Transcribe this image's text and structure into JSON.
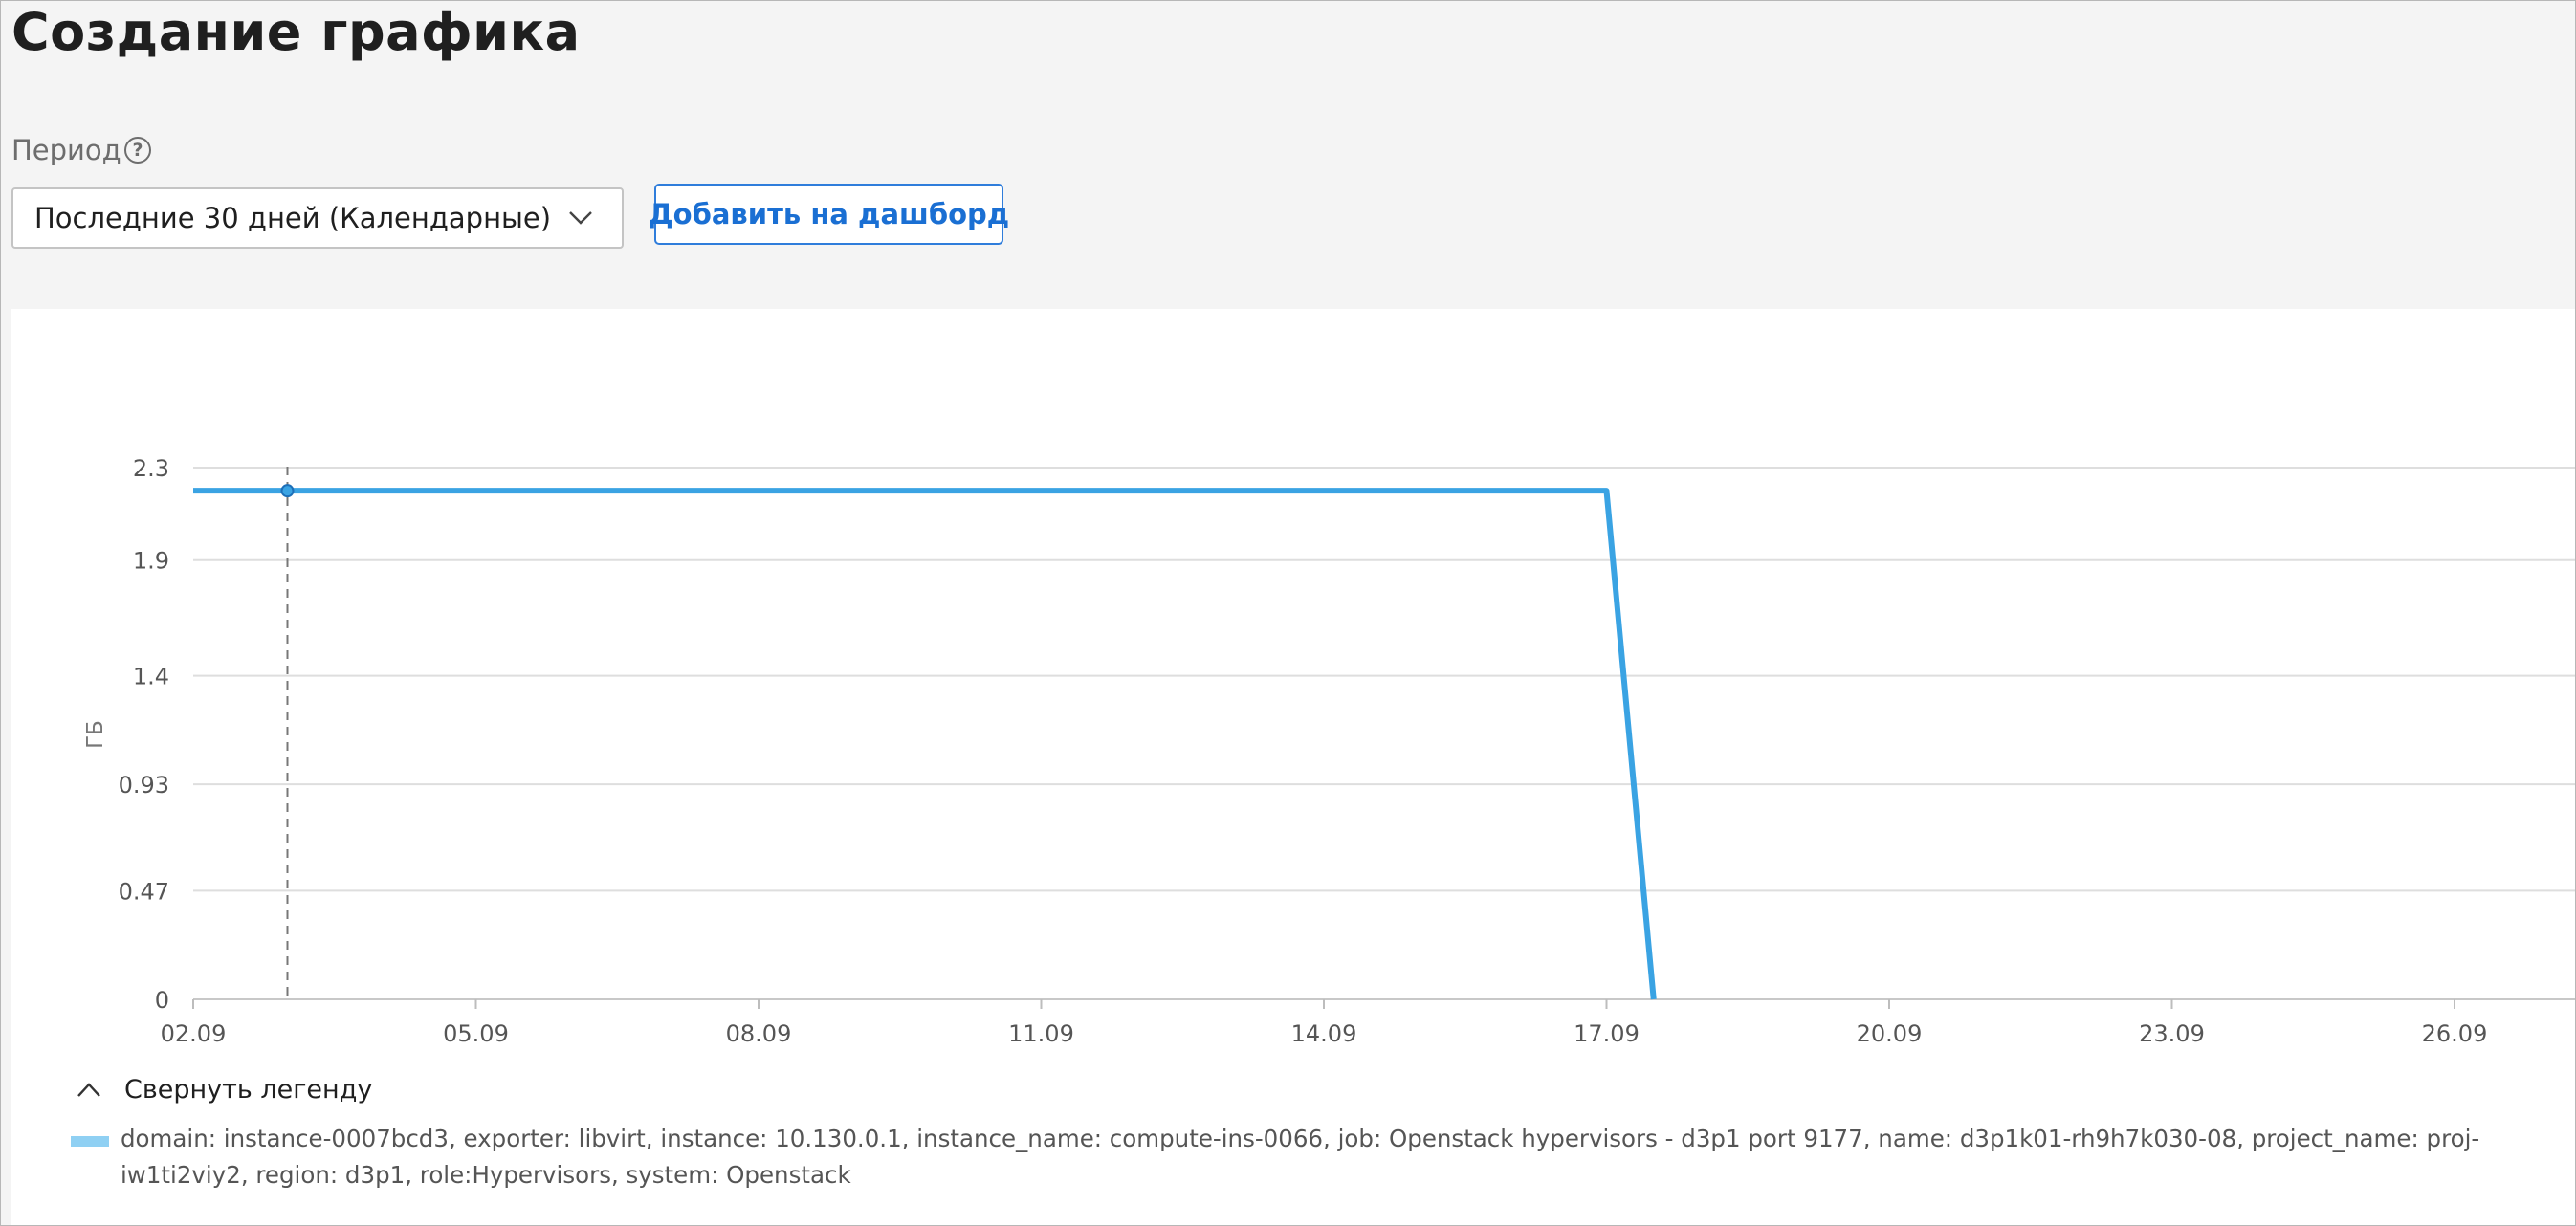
{
  "page": {
    "title": "Создание графика"
  },
  "period": {
    "label": "Период",
    "help_icon": "?",
    "selected": "Последние 30 дней (Календарные)"
  },
  "actions": {
    "add_to_dashboard": "Добавить на дашборд"
  },
  "chart_data": {
    "type": "line",
    "ylabel": "ГБ",
    "xlabel": "",
    "yticks": [
      0,
      0.47,
      0.93,
      1.4,
      1.9,
      2.3
    ],
    "ytick_labels": [
      "0",
      "0.47",
      "0.93",
      "1.4",
      "1.9",
      "2.3"
    ],
    "ylim": [
      0,
      2.3
    ],
    "xticks": [
      "02.09",
      "05.09",
      "08.09",
      "11.09",
      "14.09",
      "17.09",
      "20.09",
      "23.09",
      "26.09"
    ],
    "grid": true,
    "hover_marker_x": "03.09",
    "series": [
      {
        "name": "domain: instance-0007bcd3, exporter: libvirt, instance: 10.130.0.1, instance_name: compute-ins-0066, job: Openstack hypervisors - d3p1 port 9177, name: d3p1k01-rh9h7k030-08, project_name: proj-iw1ti2viy2, region: d3p1, role:Hypervisors, system: Openstack",
        "color": "#3aa3e3",
        "points": [
          {
            "x": "02.09",
            "y": 2.2
          },
          {
            "x": "17.09",
            "y": 2.2
          },
          {
            "x": "17.09 12:00",
            "y": 0
          }
        ]
      }
    ]
  },
  "legend": {
    "toggle_label": "Свернуть легенду",
    "swatch_color": "#8fd0f3"
  }
}
